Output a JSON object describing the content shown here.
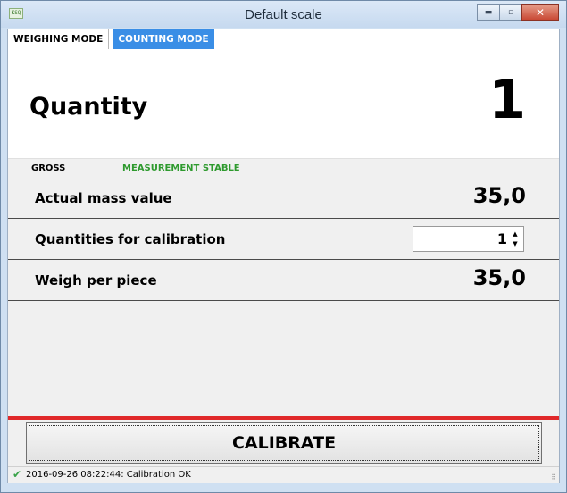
{
  "window": {
    "title": "Default scale",
    "icon_text": "KSQ",
    "controls": {
      "minimize": "▬",
      "maximize": "▫",
      "close": "✕"
    }
  },
  "tabs": [
    {
      "label": "WEIGHING MODE",
      "active": false
    },
    {
      "label": "COUNTING MODE",
      "active": true
    }
  ],
  "quantity": {
    "label": "Quantity",
    "value": "1"
  },
  "status": {
    "gross": "GROSS",
    "measurement": "MEASUREMENT STABLE",
    "measurement_color": "#2e9a2e"
  },
  "rows": [
    {
      "label": "Actual mass value",
      "value": "35,0"
    },
    {
      "label": "Quantities for calibration",
      "value": "1"
    },
    {
      "label": "Weigh per piece",
      "value": "35,0"
    }
  ],
  "calibrate_button": {
    "label": "CALIBRATE"
  },
  "statusbar": {
    "text": "2016-09-26 08:22:44: Calibration OK",
    "icon": "checkmark-icon"
  },
  "colors": {
    "accent_tab": "#3a8ee6",
    "separator": "#e0282a"
  }
}
